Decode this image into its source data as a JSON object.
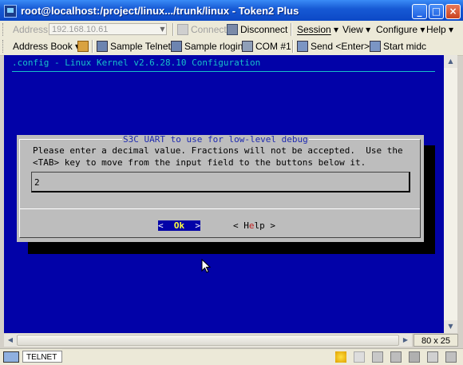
{
  "window": {
    "title": "root@localhost:/project/linux.../trunk/linux - Token2 Plus",
    "controls": {
      "minimize": "_",
      "maximize": "□",
      "close": "×"
    }
  },
  "toolbar1": {
    "address_label": "Address",
    "address_value": "192.168.10.61",
    "connect": "Connect",
    "disconnect": "Disconnect",
    "menus": [
      "Session",
      "View",
      "Configure",
      "Help"
    ]
  },
  "toolbar2": {
    "address_book": "Address Book",
    "sample_telnet": "Sample Telnet",
    "sample_rlogin": "Sample rlogin",
    "com1": "COM #1",
    "send_enter": "Send <Enter>",
    "start_midc": "Start midc"
  },
  "terminal": {
    "header": ".config - Linux Kernel v2.6.28.10 Configuration",
    "dialog": {
      "title": "S3C UART to use for low-level debug",
      "line1": "Please enter a decimal value. Fractions will not be accepted.  Use the",
      "line2": "<TAB> key to move from the input field to the buttons below it.",
      "input_value": "2",
      "ok": {
        "pre": "<  ",
        "hotkey": "Ok",
        "post": "  >"
      },
      "help": {
        "pre": "< ",
        "first": "H",
        "hotkey": "e",
        "rest": "lp",
        "post": " >"
      }
    }
  },
  "statusbar": {
    "size": "80 x 25",
    "tab": "TELNET"
  },
  "colors": {
    "terminal_bg": "#0202a8",
    "header_text": "#18c0c8",
    "dialog_bg": "#bdbdbd",
    "dialog_title": "#1e2ab0"
  }
}
